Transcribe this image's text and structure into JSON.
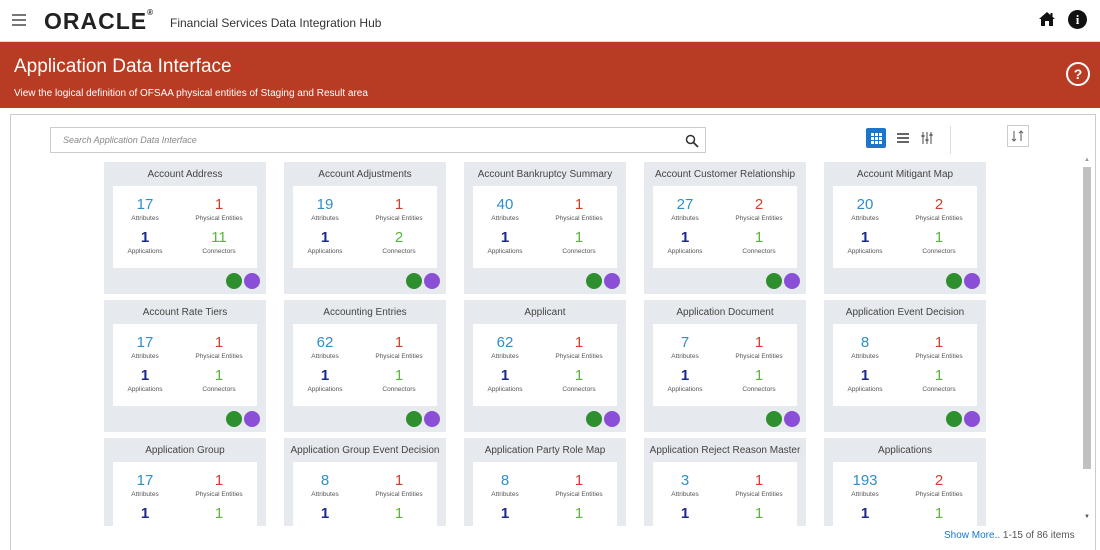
{
  "header": {
    "logo": "ORACLE",
    "app_title": "Financial Services Data Integration Hub"
  },
  "banner": {
    "title": "Application Data Interface",
    "subtitle": "View the logical definition of OFSAA physical entities of Staging and Result area",
    "help": "?"
  },
  "search": {
    "placeholder": "Search Application Data Interface"
  },
  "labels": {
    "attributes": "Attributes",
    "physical_entities": "Physical Entities",
    "applications": "Applications",
    "connectors": "Connectors"
  },
  "cards": [
    {
      "title": "Account Address",
      "attributes": "17",
      "physical_entities": "1",
      "applications": "1",
      "connectors": "11"
    },
    {
      "title": "Account Adjustments",
      "attributes": "19",
      "physical_entities": "1",
      "applications": "1",
      "connectors": "2"
    },
    {
      "title": "Account Bankruptcy Summary",
      "attributes": "40",
      "physical_entities": "1",
      "applications": "1",
      "connectors": "1"
    },
    {
      "title": "Account Customer Relationship",
      "attributes": "27",
      "physical_entities": "2",
      "applications": "1",
      "connectors": "1"
    },
    {
      "title": "Account Mitigant Map",
      "attributes": "20",
      "physical_entities": "2",
      "applications": "1",
      "connectors": "1"
    },
    {
      "title": "Account Rate Tiers",
      "attributes": "17",
      "physical_entities": "1",
      "applications": "1",
      "connectors": "1"
    },
    {
      "title": "Accounting Entries",
      "attributes": "62",
      "physical_entities": "1",
      "applications": "1",
      "connectors": "1"
    },
    {
      "title": "Applicant",
      "attributes": "62",
      "physical_entities": "1",
      "applications": "1",
      "connectors": "1"
    },
    {
      "title": "Application Document",
      "attributes": "7",
      "physical_entities": "1",
      "applications": "1",
      "connectors": "1"
    },
    {
      "title": "Application Event Decision",
      "attributes": "8",
      "physical_entities": "1",
      "applications": "1",
      "connectors": "1"
    },
    {
      "title": "Application Group",
      "attributes": "17",
      "physical_entities": "1",
      "applications": "1",
      "connectors": "1"
    },
    {
      "title": "Application Group Event Decision",
      "attributes": "8",
      "physical_entities": "1",
      "applications": "1",
      "connectors": "1"
    },
    {
      "title": "Application Party Role Map",
      "attributes": "8",
      "physical_entities": "1",
      "applications": "1",
      "connectors": "1"
    },
    {
      "title": "Application Reject Reason Master",
      "attributes": "3",
      "physical_entities": "1",
      "applications": "1",
      "connectors": "1"
    },
    {
      "title": "Applications",
      "attributes": "193",
      "physical_entities": "2",
      "applications": "1",
      "connectors": "1"
    }
  ],
  "footer": {
    "show_more": "Show More..",
    "count": "1-15 of 86 items"
  },
  "colors": {
    "banner": "#b83b23",
    "attributes": "#2e8fcb",
    "physical_entities": "#d0402b",
    "applications": "#1a2a8c",
    "connectors": "#5ab43a"
  }
}
